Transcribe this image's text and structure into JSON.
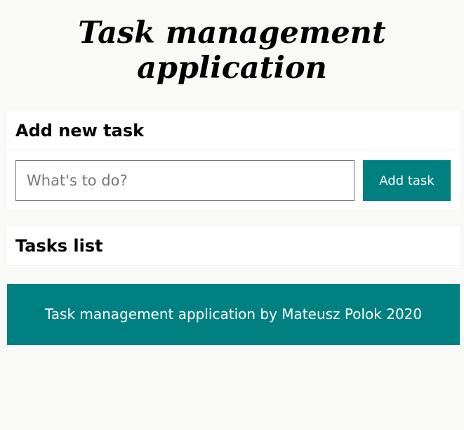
{
  "header": {
    "title": "Task management application"
  },
  "add_section": {
    "title": "Add new task",
    "input_placeholder": "What's to do?",
    "input_value": "",
    "button_label": "Add task"
  },
  "list_section": {
    "title": "Tasks list",
    "tasks": []
  },
  "footer": {
    "text": "Task management application by Mateusz Polok 2020"
  },
  "colors": {
    "accent": "#008080",
    "background": "#f9f9f7",
    "section_background": "#ffffff"
  }
}
